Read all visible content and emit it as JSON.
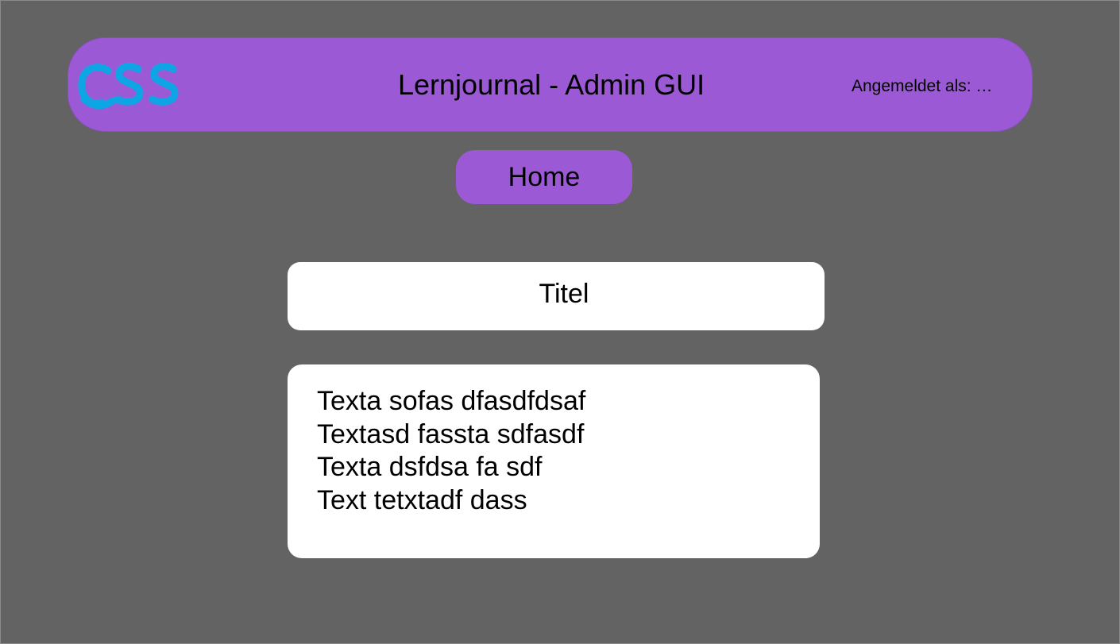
{
  "header": {
    "logo_text": "CSS",
    "title": "Lernjournal - Admin GUI",
    "user_status": "Angemeldet als: …"
  },
  "nav": {
    "home_label": "Home"
  },
  "main": {
    "title": "Titel",
    "text_lines": [
      "Texta sofas dfasdfdsaf",
      "Textasd fassta sdfasdf",
      "Texta dsfdsa fa sdf",
      "Text tetxtadf dass"
    ]
  },
  "colors": {
    "background": "#636363",
    "accent": "#9c59d6",
    "logo": "#0ea5e4",
    "card": "#ffffff"
  }
}
